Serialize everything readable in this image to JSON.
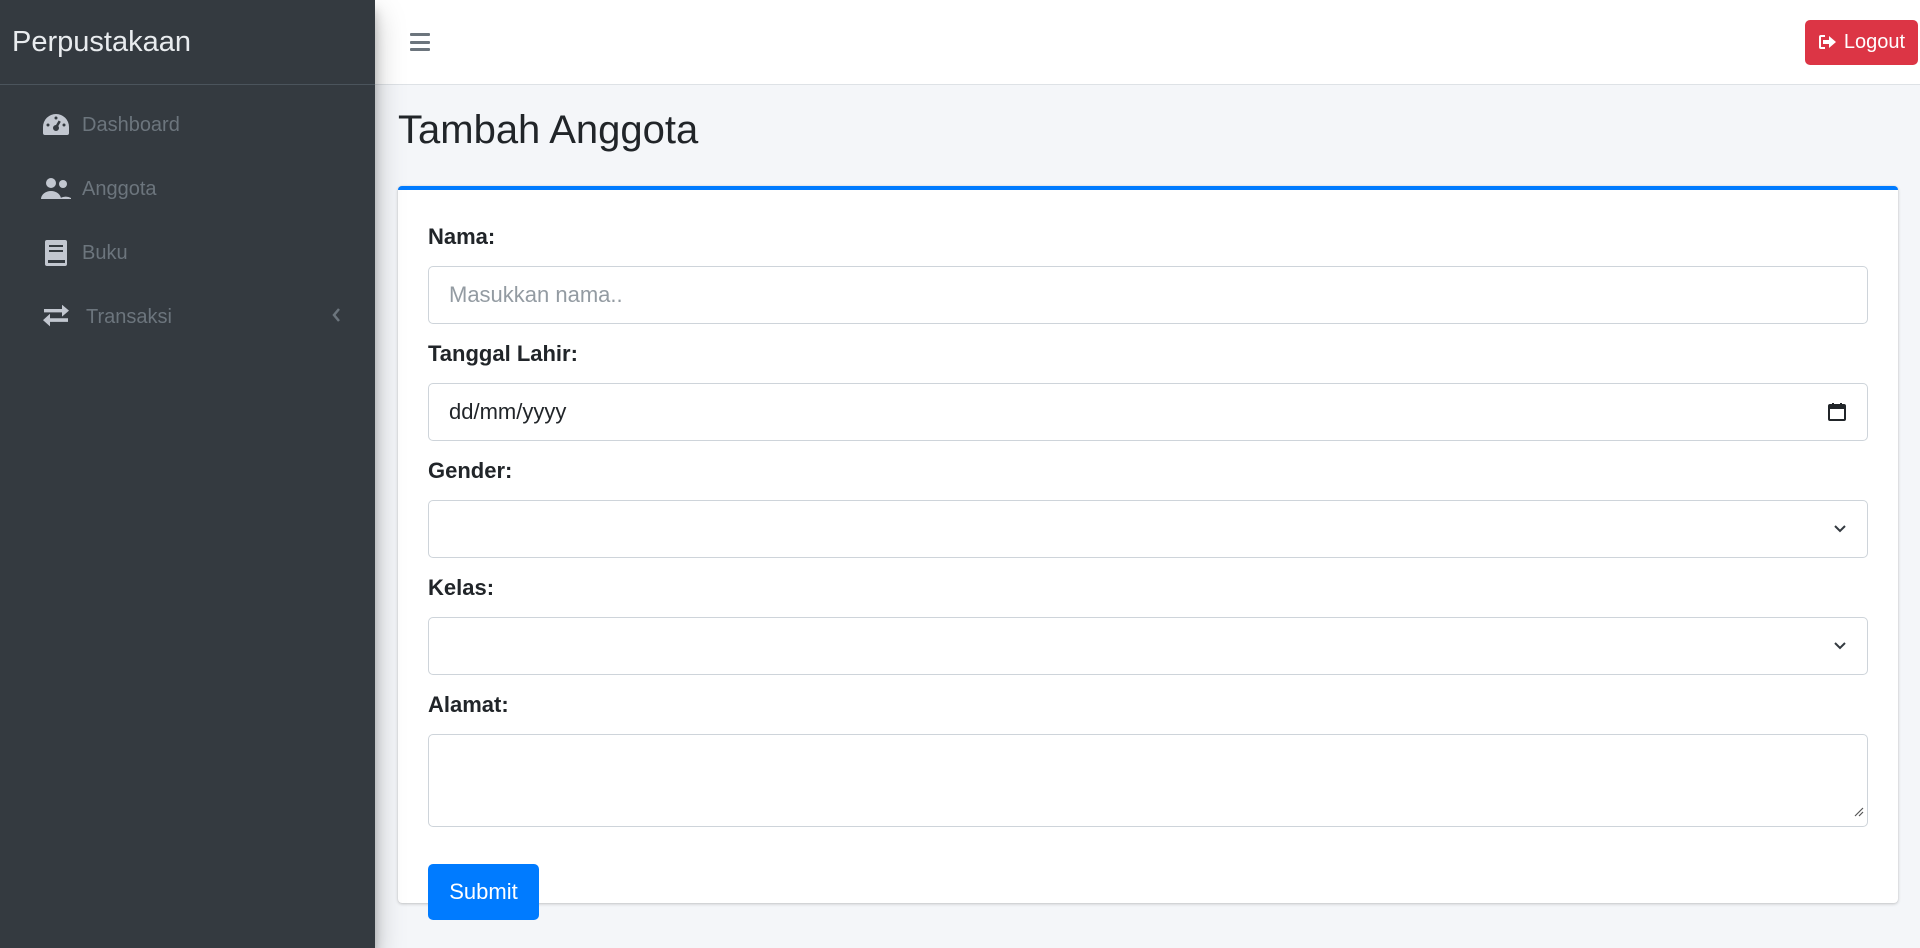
{
  "app": {
    "brand": "Perpustakaan"
  },
  "sidebar": {
    "items": [
      {
        "label": "Dashboard",
        "icon": "tachometer-icon"
      },
      {
        "label": "Anggota",
        "icon": "users-icon"
      },
      {
        "label": "Buku",
        "icon": "book-icon"
      },
      {
        "label": "Transaksi",
        "icon": "exchange-icon",
        "has_submenu": true
      }
    ]
  },
  "topbar": {
    "logout_label": "Logout"
  },
  "page": {
    "title": "Tambah Anggota"
  },
  "form": {
    "nama": {
      "label": "Nama:",
      "placeholder": "Masukkan nama..",
      "value": ""
    },
    "tanggal_lahir": {
      "label": "Tanggal Lahir:",
      "display": "dd/mm/yyyy"
    },
    "gender": {
      "label": "Gender:",
      "selected": ""
    },
    "kelas": {
      "label": "Kelas:",
      "selected": ""
    },
    "alamat": {
      "label": "Alamat:",
      "value": ""
    },
    "submit_label": "Submit"
  },
  "colors": {
    "sidebar_bg": "#343a40",
    "primary": "#007bff",
    "danger": "#dc3545",
    "content_bg": "#f4f6f9"
  }
}
